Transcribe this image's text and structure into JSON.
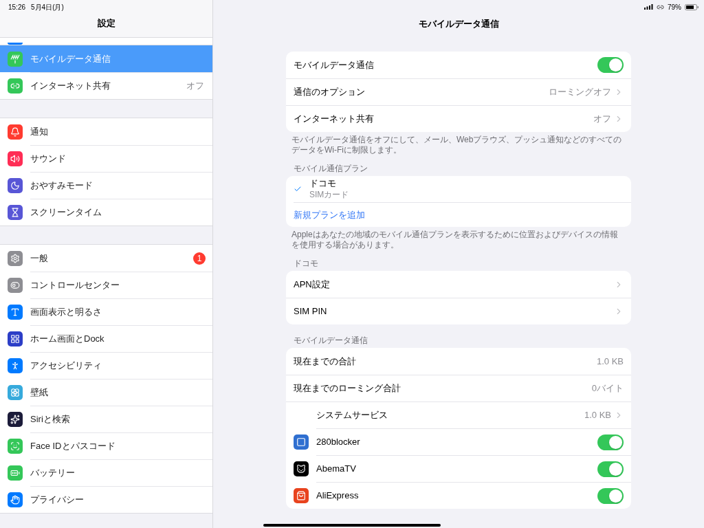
{
  "status_bar": {
    "time": "15:26",
    "date": "5月4日(月)",
    "battery": "79%"
  },
  "sidebar": {
    "title": "設定",
    "groups": [
      [
        {
          "label": "モバイルデータ通信",
          "selected": true
        },
        {
          "label": "インターネット共有",
          "value": "オフ",
          "selected": false
        }
      ],
      [
        {
          "label": "通知",
          "selected": false
        },
        {
          "label": "サウンド",
          "selected": false
        },
        {
          "label": "おやすみモード",
          "selected": false
        },
        {
          "label": "スクリーンタイム",
          "selected": false
        }
      ],
      [
        {
          "label": "一般",
          "badge": "1",
          "selected": false
        },
        {
          "label": "コントロールセンター",
          "selected": false
        },
        {
          "label": "画面表示と明るさ",
          "selected": false
        },
        {
          "label": "ホーム画面とDock",
          "selected": false
        },
        {
          "label": "アクセシビリティ",
          "selected": false
        },
        {
          "label": "壁紙",
          "selected": false
        },
        {
          "label": "Siriと検索",
          "selected": false
        },
        {
          "label": "Face IDとパスコード",
          "selected": false
        },
        {
          "label": "バッテリー",
          "selected": false
        },
        {
          "label": "プライバシー",
          "selected": false
        }
      ]
    ]
  },
  "detail": {
    "title": "モバイルデータ通信",
    "sections": [
      {
        "rows": [
          {
            "kind": "toggle",
            "label": "モバイルデータ通信",
            "on": true
          },
          {
            "kind": "detail",
            "label": "通信のオプション",
            "value": "ローミングオフ"
          },
          {
            "kind": "detail",
            "label": "インターネット共有",
            "value": "オフ"
          }
        ],
        "footer": "モバイルデータ通信をオフにして、メール、Webブラウズ、プッシュ通知などのすべてのデータをWi-Fiに制限します。"
      },
      {
        "header": "モバイル通信プラン",
        "rows": [
          {
            "kind": "plan",
            "label": "ドコモ",
            "sub": "SIMカード",
            "selected": true
          },
          {
            "kind": "action",
            "label": "新規プランを追加"
          }
        ],
        "footer": "Appleはあなたの地域のモバイル通信プランを表示するために位置およびデバイスの情報を使用する場合があります。"
      },
      {
        "header": "ドコモ",
        "rows": [
          {
            "kind": "detail",
            "label": "APN設定"
          },
          {
            "kind": "detail",
            "label": "SIM PIN"
          }
        ]
      },
      {
        "header": "モバイルデータ通信",
        "rows": [
          {
            "kind": "value",
            "label": "現在までの合計",
            "value": "1.0 KB"
          },
          {
            "kind": "value",
            "label": "現在までのローミング合計",
            "value": "0バイト"
          },
          {
            "kind": "service",
            "label": "システムサービス",
            "value": "1.0 KB"
          },
          {
            "kind": "app",
            "label": "280blocker",
            "on": true
          },
          {
            "kind": "app",
            "label": "AbemaTV",
            "on": true
          },
          {
            "kind": "app",
            "label": "AliExpress",
            "on": true
          }
        ]
      }
    ]
  }
}
